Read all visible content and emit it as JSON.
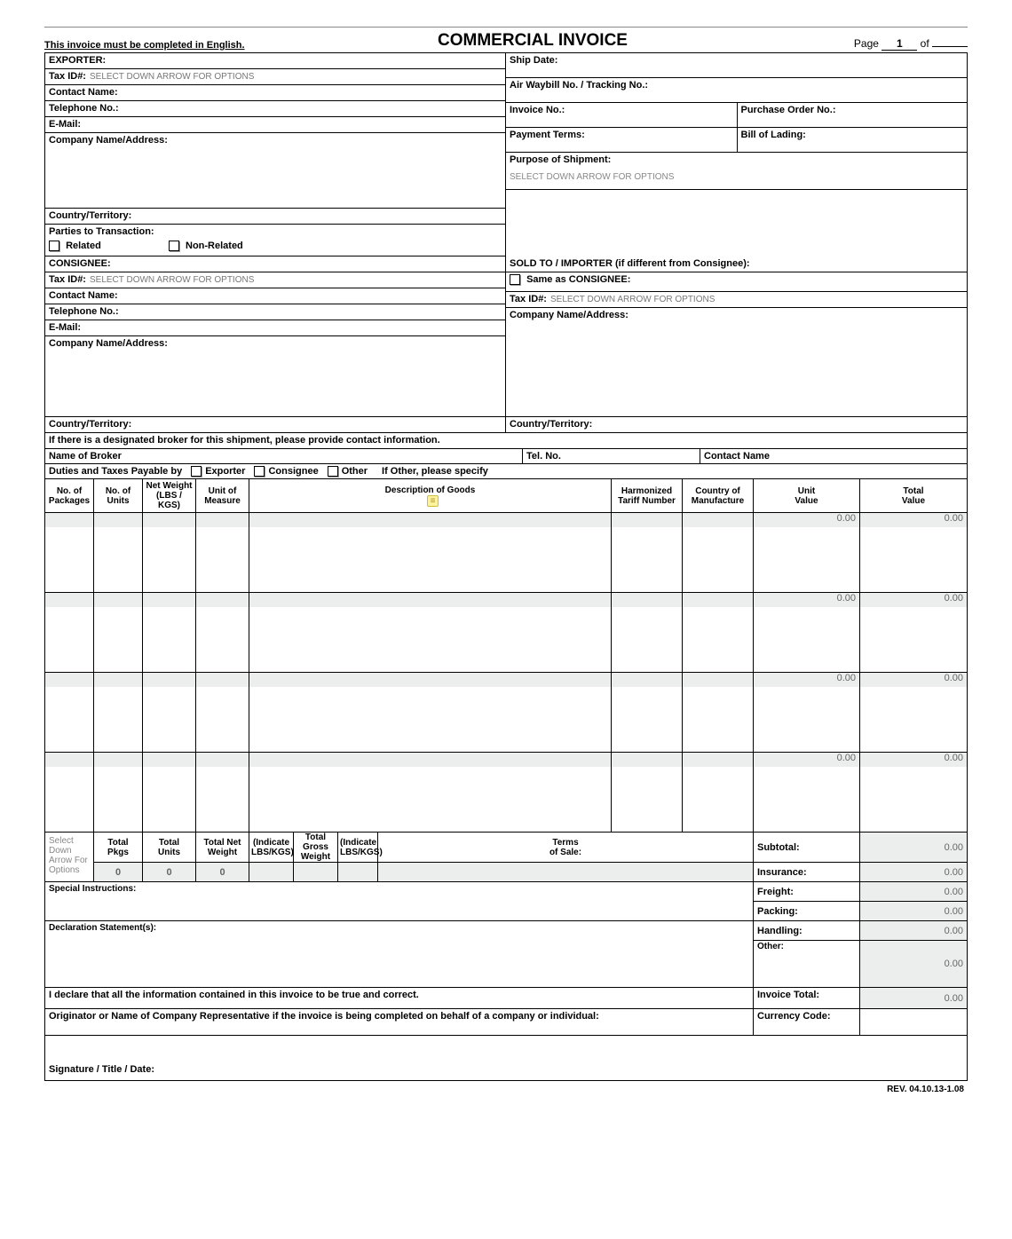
{
  "header": {
    "title": "COMMERCIAL INVOICE",
    "english_note": "This invoice must be completed in English.",
    "page_label": "Page",
    "page_num": "1",
    "page_of": "of"
  },
  "exporter": {
    "label": "EXPORTER:",
    "tax_label": "Tax ID#:",
    "tax_hint": "SELECT DOWN ARROW FOR OPTIONS",
    "contact": "Contact Name:",
    "phone": "Telephone No.:",
    "email": "E-Mail:",
    "company": "Company Name/Address:",
    "country": "Country/Territory:",
    "parties": "Parties to Transaction:",
    "related": "Related",
    "nonrelated": "Non-Related"
  },
  "ship": {
    "date": "Ship Date:",
    "awb": "Air Waybill No. / Tracking No.:",
    "invoice": "Invoice No.:",
    "po": "Purchase Order No.:",
    "payment": "Payment Terms:",
    "bol": "Bill of Lading:",
    "purpose": "Purpose of Shipment:",
    "purpose_hint": "SELECT DOWN ARROW FOR OPTIONS"
  },
  "consignee": {
    "label": "CONSIGNEE:",
    "tax_label": "Tax ID#:",
    "tax_hint": "SELECT DOWN ARROW FOR OPTIONS",
    "contact": "Contact Name:",
    "phone": "Telephone No.:",
    "email": "E-Mail:",
    "company": "Company Name/Address:",
    "country": "Country/Territory:"
  },
  "soldto": {
    "label": "SOLD TO / IMPORTER (if different from Consignee):",
    "same": "Same as CONSIGNEE:",
    "tax_label": "Tax ID#:",
    "tax_hint": "SELECT DOWN ARROW FOR OPTIONS",
    "company": "Company Name/Address:",
    "country": "Country/Territory:"
  },
  "broker": {
    "heading": "If there is a designated broker for this shipment, please provide contact information.",
    "name": "Name of Broker",
    "tel": "Tel. No.",
    "contact": "Contact Name"
  },
  "duties": {
    "label": "Duties and Taxes Payable by",
    "exporter": "Exporter",
    "consignee": "Consignee",
    "other": "Other",
    "specify": "If Other, please specify"
  },
  "items_head": {
    "pkgs": "No. of\nPackages",
    "units": "No. of\nUnits",
    "netw": "Net Weight\n(LBS / KGS)",
    "uom": "Unit of\nMeasure",
    "desc": "Description of Goods",
    "hts": "Harmonized\nTariff Number",
    "com": "Country of\nManufacture",
    "uval": "Unit\nValue",
    "tval": "Total\nValue"
  },
  "items": [
    {
      "unit_value": "0.00",
      "total_value": "0.00"
    },
    {
      "unit_value": "0.00",
      "total_value": "0.00"
    },
    {
      "unit_value": "0.00",
      "total_value": "0.00"
    },
    {
      "unit_value": "0.00",
      "total_value": "0.00"
    }
  ],
  "totals_head": {
    "tpkgs": "Total\nPkgs",
    "tunits": "Total\nUnits",
    "tnet": "Total Net\nWeight",
    "ind1": "(Indicate\nLBS/KGS)",
    "tgross": "Total Gross\nWeight",
    "ind2": "(Indicate\nLBS/KGS)",
    "terms": "Terms\nof Sale:",
    "terms_hint": "Select Down Arrow For Options"
  },
  "totals": {
    "tpkgs": "0",
    "tunits": "0",
    "tnet": "0",
    "subtotal_lbl": "Subtotal:",
    "subtotal": "0.00",
    "insurance_lbl": "Insurance:",
    "insurance": "0.00",
    "freight_lbl": "Freight:",
    "freight": "0.00",
    "packing_lbl": "Packing:",
    "packing": "0.00",
    "handling_lbl": "Handling:",
    "handling": "0.00",
    "other_lbl": "Other:",
    "other": "0.00",
    "special": "Special Instructions:",
    "decl": "Declaration Statement(s):"
  },
  "bottom": {
    "declare": "I declare that all the information contained in this invoice to be true and correct.",
    "orig": "Originator or Name of Company Representative if the invoice is being completed on behalf of a company or individual:",
    "inv_total_lbl": "Invoice Total:",
    "inv_total": "0.00",
    "currency_lbl": "Currency Code:",
    "sig": "Signature / Title / Date:"
  },
  "rev": "REV. 04.10.13-1.08"
}
